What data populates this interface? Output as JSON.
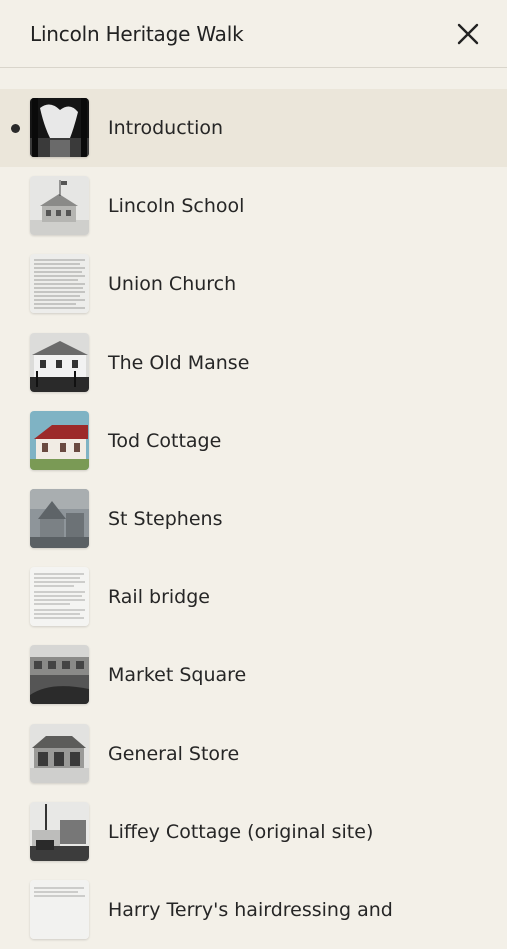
{
  "header": {
    "title": "Lincoln Heritage Walk",
    "close_icon": "close-icon"
  },
  "stops": [
    {
      "label": "Introduction",
      "active": true,
      "thumb": "photo-trees"
    },
    {
      "label": "Lincoln School",
      "active": false,
      "thumb": "photo-school"
    },
    {
      "label": "Union Church",
      "active": false,
      "thumb": "photo-document"
    },
    {
      "label": "The Old Manse",
      "active": false,
      "thumb": "photo-house"
    },
    {
      "label": "Tod Cottage",
      "active": false,
      "thumb": "photo-cottage"
    },
    {
      "label": "St Stephens",
      "active": false,
      "thumb": "photo-church"
    },
    {
      "label": "Rail bridge",
      "active": false,
      "thumb": "photo-document"
    },
    {
      "label": "Market Square",
      "active": false,
      "thumb": "photo-square"
    },
    {
      "label": "General Store",
      "active": false,
      "thumb": "photo-store"
    },
    {
      "label": "Liffey Cottage (original site)",
      "active": false,
      "thumb": "photo-liffey"
    },
    {
      "label": "Harry Terry's hairdressing and",
      "active": false,
      "thumb": "photo-document"
    }
  ],
  "colors": {
    "background": "#f3f0e8",
    "active_row": "#ebe6da",
    "text": "#262626"
  }
}
